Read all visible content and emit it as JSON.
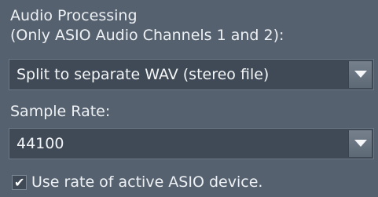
{
  "audio_processing": {
    "label_line1": "Audio Processing",
    "label_line2": "(Only ASIO Audio Channels 1 and 2):",
    "selected": "Split to separate WAV (stereo file)",
    "arrow_icon": "chevron-down-icon"
  },
  "sample_rate": {
    "label": "Sample Rate:",
    "selected": "44100",
    "arrow_icon": "chevron-down-icon"
  },
  "use_active_rate": {
    "checked": true,
    "label": "Use rate of active ASIO device."
  },
  "colors": {
    "background": "#55616f",
    "field": "#3f4a56",
    "text": "#eef1f4"
  }
}
